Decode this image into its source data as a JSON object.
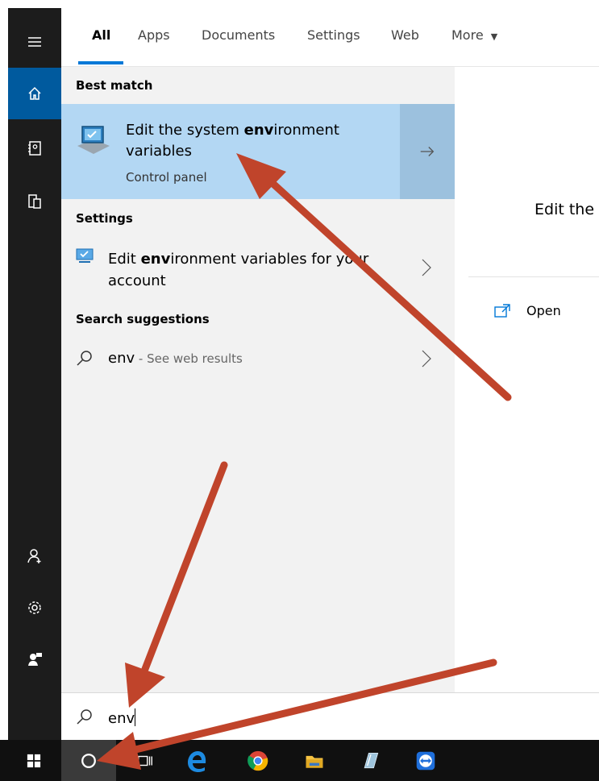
{
  "tabs": [
    {
      "label": "All",
      "active": true
    },
    {
      "label": "Apps"
    },
    {
      "label": "Documents"
    },
    {
      "label": "Settings"
    },
    {
      "label": "Web"
    },
    {
      "label": "More"
    }
  ],
  "results": {
    "best_match_title": "Best match",
    "best_match": {
      "title_pre": "Edit the system ",
      "title_bold": "env",
      "title_post": "ironment",
      "title_line2": "variables",
      "subtitle": "Control panel"
    },
    "settings_title": "Settings",
    "settings_item": {
      "pre": "Edit ",
      "bold": "env",
      "post": "ironment variables for your",
      "line2": "account"
    },
    "suggestions_title": "Search suggestions",
    "suggestion": {
      "bold": "env",
      "rest": " - See web results"
    }
  },
  "preview": {
    "title": "Edit the",
    "open_label": "Open"
  },
  "search": {
    "query": "env"
  },
  "colors": {
    "accent": "#0078d7",
    "highlight": "#b3d7f3",
    "annotation": "#c0442b"
  }
}
